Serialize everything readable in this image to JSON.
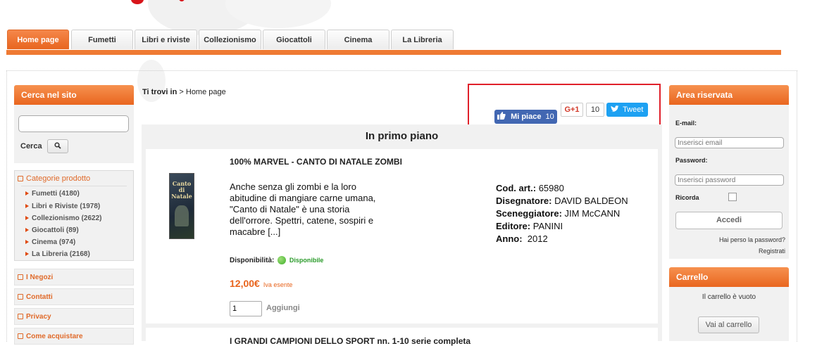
{
  "nav": {
    "tabs": [
      "Home page",
      "Fumetti",
      "Libri e riviste",
      "Collezionismo",
      "Giocattoli",
      "Cinema",
      "La Libreria"
    ]
  },
  "search": {
    "title": "Cerca nel sito",
    "value": "",
    "label": "Cerca"
  },
  "categories": {
    "title": "Categorie prodotto",
    "items": [
      "Fumetti (4180)",
      "Libri e Riviste (1978)",
      "Collezionismo (2622)",
      "Giocattoli (89)",
      "Cinema (974)",
      "La Libreria (2168)"
    ]
  },
  "links": [
    "I Negozi",
    "Contatti",
    "Privacy",
    "Come acquistare"
  ],
  "breadcrumb": {
    "prefix": "Ti trovi in",
    "separator": ">",
    "current": "Home page"
  },
  "social": {
    "like_label": "Mi piace",
    "like_count": "10",
    "gplus_label": "G+1",
    "gplus_count": "10",
    "tweet_label": "Tweet"
  },
  "featured": {
    "title": "In primo piano",
    "product": {
      "title": "100% MARVEL - CANTO DI NATALE ZOMBI",
      "cover_title": "Canto di Natale",
      "description": "Anche senza gli zombi e la loro abitudine di mangiare carne umana, \"Canto di Natale\" è una storia dell'orrore. Spettri, catene, sospiri e macabre [...]",
      "availability_label": "Disponibilità:",
      "availability": "Disponibile",
      "price": "12,00€",
      "tax_note": "Iva esente",
      "quantity": "1",
      "add_label": "Aggiungi",
      "details": [
        {
          "label": "Cod. art.:",
          "value": "65980"
        },
        {
          "label": "Disegnatore:",
          "value": "DAVID BALDEON"
        },
        {
          "label": "Sceneggiatore:",
          "value": "JIM McCANN"
        },
        {
          "label": "Editore:",
          "value": "PANINI"
        },
        {
          "label": "Anno:",
          "value": "2012"
        }
      ]
    },
    "next_product_title": "I GRANDI CAMPIONI DELLO SPORT nn. 1-10 serie completa"
  },
  "login": {
    "title": "Area riservata",
    "email_label": "E-mail:",
    "email_placeholder": "Inserisci email",
    "password_label": "Password:",
    "password_placeholder": "Inserisci password",
    "remember_label": "Ricorda",
    "submit_label": "Accedi",
    "forgot_label": "Hai perso la password?",
    "register_label": "Registrati"
  },
  "cart": {
    "title": "Carrello",
    "empty_text": "Il carrello è vuoto",
    "button_label": "Vai al carrello"
  },
  "colors": {
    "accent": "#ef7a33",
    "facebook": "#4267b2",
    "twitter": "#1da1f2",
    "available": "#2a9a2a",
    "highlight_box": "#e0202a"
  }
}
